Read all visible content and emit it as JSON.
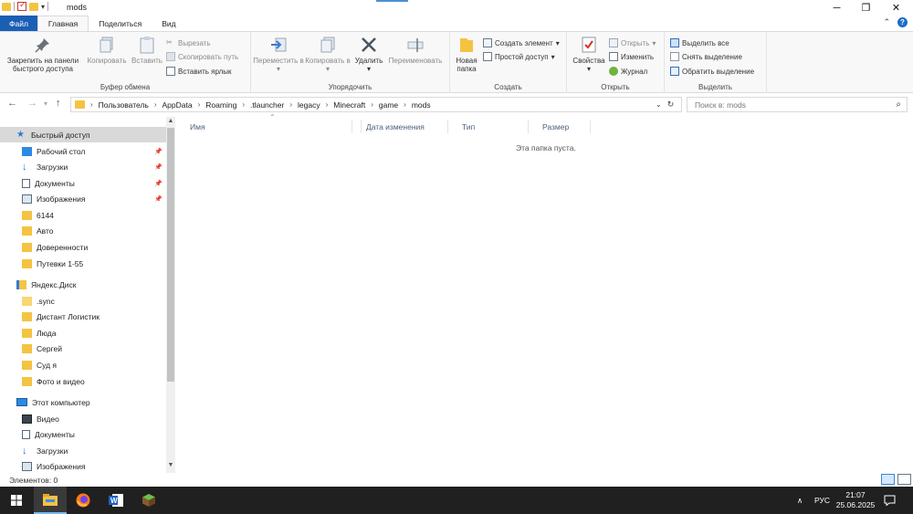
{
  "window": {
    "title": "mods",
    "controls": {
      "minimize": "─",
      "maximize": "❐",
      "close": "✕"
    }
  },
  "ribbon_tabs": {
    "file": "Файл",
    "home": "Главная",
    "share": "Поделиться",
    "view": "Вид",
    "collapse": "⌃",
    "help": "?"
  },
  "ribbon": {
    "clipboard": {
      "label": "Буфер обмена",
      "pin": "Закрепить на панели быстрого доступа",
      "copy": "Копировать",
      "paste": "Вставить",
      "cut": "Вырезать",
      "copy_path": "Скопировать путь",
      "paste_shortcut": "Вставить ярлык"
    },
    "organize": {
      "label": "Упорядочить",
      "move_to": "Переместить в",
      "copy_to": "Копировать в",
      "delete": "Удалить",
      "rename": "Переименовать"
    },
    "new": {
      "label": "Создать",
      "new_folder": "Новая папка",
      "new_item": "Создать элемент",
      "easy_access": "Простой доступ"
    },
    "open": {
      "label": "Открыть",
      "properties": "Свойства",
      "open": "Открыть",
      "edit": "Изменить",
      "history": "Журнал"
    },
    "select": {
      "label": "Выделить",
      "select_all": "Выделить все",
      "select_none": "Снять выделение",
      "invert": "Обратить выделение"
    }
  },
  "address": {
    "path": [
      "Пользователь",
      "AppData",
      "Roaming",
      ".tlauncher",
      "legacy",
      "Minecraft",
      "game",
      "mods"
    ],
    "search_placeholder": "Поиск в: mods"
  },
  "nav_pane": {
    "quick_access": "Быстрый доступ",
    "quick_items": [
      {
        "label": "Рабочий стол",
        "pinned": true
      },
      {
        "label": "Загрузки",
        "pinned": true
      },
      {
        "label": "Документы",
        "pinned": true
      },
      {
        "label": "Изображения",
        "pinned": true
      },
      {
        "label": "6144",
        "pinned": false
      },
      {
        "label": "Авто",
        "pinned": false
      },
      {
        "label": "Доверенности",
        "pinned": false
      },
      {
        "label": "Путевки 1-55",
        "pinned": false
      }
    ],
    "yandex": "Яндекс.Диск",
    "yandex_items": [
      ".sync",
      "Дистант Логистик",
      "Люда",
      "Сергей",
      "Суд я",
      "Фото и видео"
    ],
    "this_pc": "Этот компьютер",
    "pc_items": [
      "Видео",
      "Документы",
      "Загрузки",
      "Изображения"
    ],
    "pin_glyph": "📌"
  },
  "columns": {
    "name": "Имя",
    "date": "Дата изменения",
    "type": "Тип",
    "size": "Размер"
  },
  "content": {
    "empty_message": "Эта папка пуста."
  },
  "status": {
    "items": "Элементов: 0"
  },
  "taskbar": {
    "lang": "РУС",
    "time": "21:07",
    "date": "25.06.2025"
  },
  "colors": {
    "file_tab": "#1a5fb4",
    "folder": "#f5c342",
    "taskbar": "#202020",
    "selection": "#d9d9d9"
  }
}
